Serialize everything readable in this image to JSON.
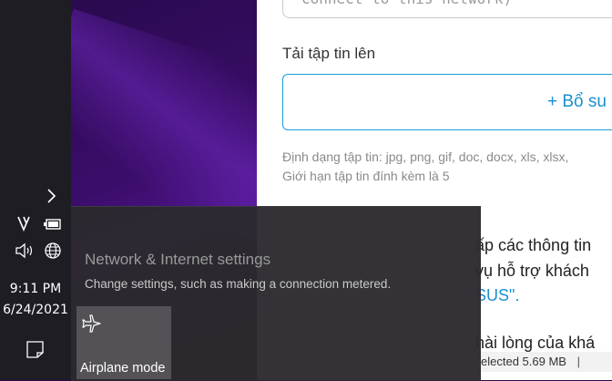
{
  "taskbar": {
    "icons": [
      "chevron-right-icon",
      "v-app-icon",
      "battery-icon",
      "volume-icon",
      "globe-network-icon",
      "notification-icon"
    ],
    "time": "9:11 PM",
    "date": "6/24/2021"
  },
  "page": {
    "prev_field_text": "connect to this network)",
    "upload_label": "Tải tập tin lên",
    "add_button": "+ Bổ su",
    "hint_formats": "Định dạng tập tin: jpg, png, gif, doc, docx, xls, xlsx,",
    "hint_limit": "Giới hạn tập tin đính kèm là 5",
    "body_lines": [
      "ấp các thông tin",
      "vụ hỗ trợ khách",
      "SUS\".",
      "hài lòng của khá"
    ]
  },
  "status": {
    "text": "elected  5.69 MB"
  },
  "flyout": {
    "network_title": "Network & Internet settings",
    "network_subtitle": "Change settings, such as making a connection metered.",
    "tile_label": "Airplane mode",
    "tile_icon": "airplane-icon"
  },
  "colors": {
    "accent": "#1a8fd0",
    "taskbar_bg": "#1f1d24",
    "flyout_bg": "#2c2a2e",
    "tile_bg": "#545257"
  }
}
